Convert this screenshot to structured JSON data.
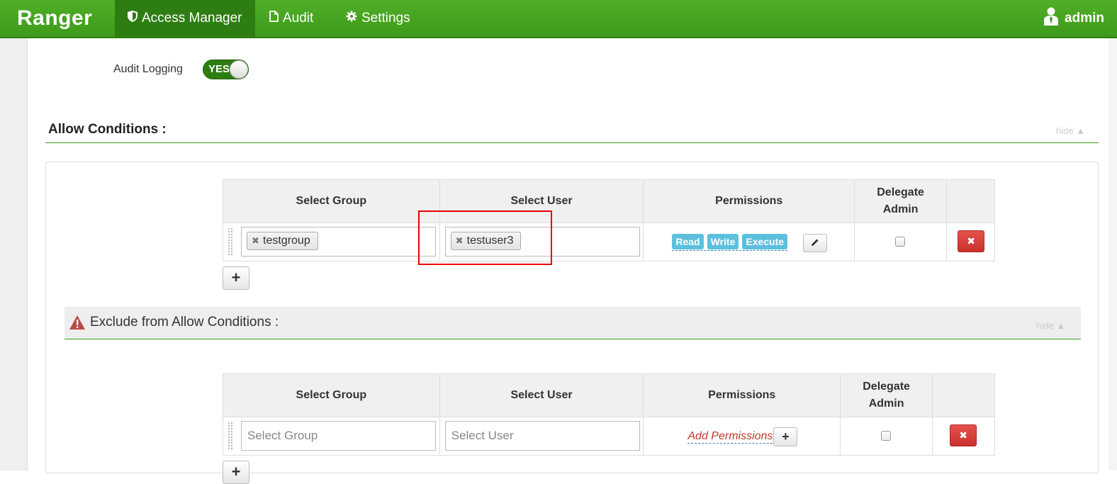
{
  "nav": {
    "brand": "Ranger",
    "items": [
      {
        "label": "Access Manager",
        "icon": "shield-icon"
      },
      {
        "label": "Audit",
        "icon": "file-icon"
      },
      {
        "label": "Settings",
        "icon": "gear-icon"
      }
    ],
    "user": "admin"
  },
  "audit_logging": {
    "label": "Audit Logging",
    "toggle": "YES"
  },
  "allow": {
    "title": "Allow Conditions :",
    "hide": "hide",
    "headers": [
      "Select Group",
      "Select User",
      "Permissions",
      "Delegate Admin"
    ],
    "row": {
      "group_tag": "testgroup",
      "user_tag": "testuser3",
      "permissions": [
        "Read",
        "Write",
        "Execute"
      ],
      "delegate_admin": false
    },
    "add_row": "+"
  },
  "exclude": {
    "title": "Exclude from Allow Conditions :",
    "hide": "hide",
    "headers": [
      "Select Group",
      "Select User",
      "Permissions",
      "Delegate Admin"
    ],
    "row": {
      "group_placeholder": "Select Group",
      "user_placeholder": "Select User",
      "add_permissions": "Add Permissions",
      "delegate_admin": false
    }
  },
  "colors": {
    "brand_green": "#3f9a1b",
    "danger": "#c9302c",
    "info": "#5bc0de",
    "highlight": "#e00000"
  }
}
